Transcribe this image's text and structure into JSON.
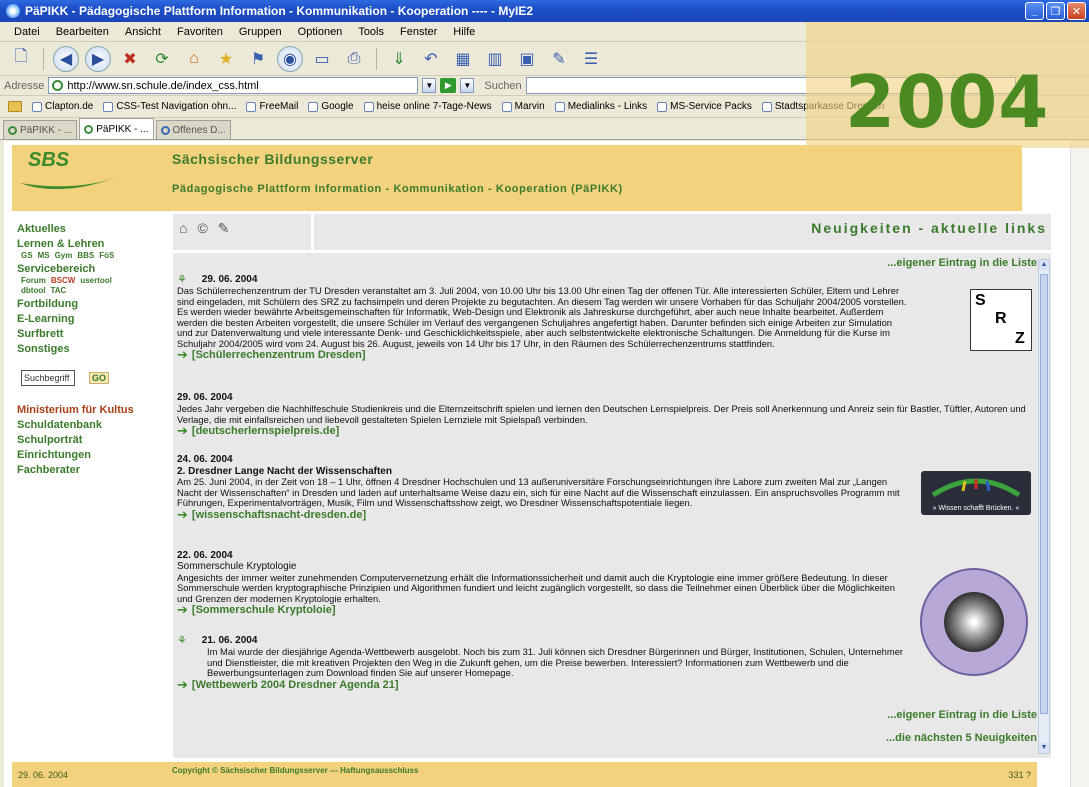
{
  "window": {
    "title": "PäPIKK - Pädagogische Plattform Information - Kommunikation - Kooperation ---- - MyIE2"
  },
  "menu": [
    "Datei",
    "Bearbeiten",
    "Ansicht",
    "Favoriten",
    "Gruppen",
    "Optionen",
    "Tools",
    "Fenster",
    "Hilfe"
  ],
  "address": {
    "label": "Adresse",
    "url": "http://www.sn.schule.de/index_css.html",
    "search_label": "Suchen"
  },
  "bookmarks": [
    "Clapton.de",
    "CSS-Test Navigation ohn...",
    "FreeMail",
    "Google",
    "heise online 7-Tage-News",
    "Marvin",
    "Medialinks - Links",
    "MS-Service Packs",
    "Stadtsparkasse Dresden"
  ],
  "tabs": [
    "PäPIKK - ...",
    "PäPIKK - ...",
    "Offenes D..."
  ],
  "overlay_year": "2004",
  "site": {
    "logo": "SBS",
    "title": "Sächsischer Bildungsserver",
    "subtitle": "Pädagogische Plattform Information - Kommunikation - Kooperation (PäPIKK)"
  },
  "nav": {
    "aktuelles": "Aktuelles",
    "lernen": "Lernen & Lehren",
    "lernen_sub": [
      "GS",
      "MS",
      "Gym",
      "BBS",
      "FöS"
    ],
    "service": "Servicebereich",
    "service_sub1": [
      "Forum",
      "BSCW",
      "usertool"
    ],
    "service_sub2": [
      "dbtool",
      "TAC"
    ],
    "fortbildung": "Fortbildung",
    "elearning": "E-Learning",
    "surfbrett": "Surfbrett",
    "sonstiges": "Sonstiges",
    "search_placeholder": "Suchbegriff",
    "go": "GO",
    "kultus": "Ministerium für Kultus",
    "schuldatenbank": "Schuldatenbank",
    "schulportraet": "Schulporträt",
    "einrichtungen": "Einrichtungen",
    "fachberater": "Fachberater"
  },
  "section_title": "Neuigkeiten - aktuelle links",
  "eintrag_link": "...eigener Eintrag in die Liste",
  "next_link": "...die nächsten 5 Neuigkeiten",
  "news": [
    {
      "date": "29. 06. 2004",
      "text": "Das Schülerrechenzentrum der TU Dresden veranstaltet am 3. Juli 2004, von 10.00 Uhr bis 13.00 Uhr einen Tag der offenen Tür. Alle interessierten Schüler, Eltern und Lehrer sind eingeladen, mit Schülern des SRZ zu fachsimpeln und deren Projekte zu begutachten. An diesem Tag werden wir unsere Vorhaben für das Schuljahr 2004/2005 vorstellen. Es werden wieder bewährte Arbeitsgemeinschaften für Informatik, Web-Design und Elektronik als Jahreskurse durchgeführt, aber auch neue Inhalte bearbeitet. Außerdem werden die besten Arbeiten vorgestellt, die unsere Schüler im Verlauf des vergangenen Schuljahres angefertigt haben. Darunter befinden sich einige Arbeiten zur Simulation und zur Datenverwaltung und viele interessante Denk- und Geschicklichkeitsspiele, aber auch selbstentwickelte elektronische Schaltungen. Die Anmeldung für die Kurse im Schuljahr 2004/2005 wird vom 24. August bis 26. August, jeweils von 14 Uhr bis 17 Uhr, in den Räumen des Schülerrechenzentrums stattfinden.",
      "link": "[Schülerrechenzentrum Dresden]"
    },
    {
      "date": "29. 06. 2004",
      "text": "Jedes Jahr vergeben die Nachhilfeschule Studienkreis und die Elternzeitschrift spielen und lernen den Deutschen Lernspielpreis. Der Preis soll Anerkennung und Anreiz sein für Bastler, Tüftler, Autoren und Verlage, die mit einfallsreichen und liebevoll gestalteten Spielen Lernziele mit Spielspaß verbinden.",
      "link": "[deutscherlernspielpreis.de]"
    },
    {
      "date": "24. 06. 2004",
      "title": "2. Dresdner Lange Nacht der Wissenschaften",
      "text": "Am 25. Juni 2004, in der Zeit von 18 – 1 Uhr, öffnen 4 Dresdner Hochschulen und 13 außeruniversitäre Forschungseinrichtungen ihre Labore zum zweiten Mal zur „Langen Nacht der Wissenschaften“ in Dresden und laden auf unterhaltsame Weise dazu ein, sich für eine Nacht auf die Wissenschaft einzulassen. Ein anspruchsvolles Programm mit Führungen, Experimentalvorträgen, Musik, Film und Wissenschaftsshow zeigt, wo Dresdner Wissenschaftspotentiale liegen.",
      "link": "[wissenschaftsnacht-dresden.de]",
      "logo_caption": "» Wissen schafft Brücken. «"
    },
    {
      "date": "22. 06. 2004",
      "title": "Sommerschule Kryptologie",
      "text": "Angesichts der immer weiter zunehmenden Computervernetzung erhält die Informationssicherheit und damit auch die Kryptologie eine immer größere Bedeutung. In dieser Sommerschule werden kryptographische Prinzipien und Algorithmen fundiert und leicht zugänglich vorgestellt, so dass die Teilnehmer einen Überblick über die Möglichkeiten und Grenzen der modernen Kryptologie erhalten.",
      "link": "[Sommerschule Kryptoloie]"
    },
    {
      "date": "21. 06. 2004",
      "text": "Im Mai wurde der diesjährige Agenda-Wettbewerb ausgelobt. Noch bis zum 31. Juli können sich Dresdner Bürgerinnen und Bürger, Institutionen, Schulen, Unternehmer und Dienstleister, die mit kreativen Projekten den Weg in die Zukunft gehen, um die Preise bewerben. Interessiert? Informationen zum Wettbewerb und die Bewerbungsunterlagen zum Download finden Sie auf unserer Homepage.",
      "link": "[Wettbewerb 2004 Dresdner Agenda 21]"
    }
  ],
  "footer": {
    "date": "29. 06. 2004",
    "copyright": "Copyright © Sächsischer Bildungsserver   --- Haftungsausschluss",
    "count": "331 ?"
  }
}
